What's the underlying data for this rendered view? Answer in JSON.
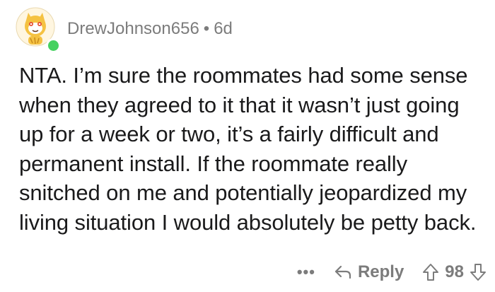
{
  "comment": {
    "username": "DrewJohnson656",
    "separator": "•",
    "age": "6d",
    "body": "NTA. I’m sure the roommates had some sense when they agreed to it that it wasn’t just going up for a week or two, it’s a fairly difficult and permanent install. If the roommate really snitched on me and potentially jeopardized my living situation I would absolutely be petty back."
  },
  "actions": {
    "more_label": "•••",
    "reply_label": "Reply",
    "score": "98"
  },
  "icons": {
    "avatar": "snoo-avatar-icon",
    "reply": "reply-arrow-icon",
    "upvote": "upvote-arrow-icon",
    "downvote": "downvote-arrow-icon"
  },
  "colors": {
    "text": "#1a1a1b",
    "meta": "#7c7c7c",
    "online": "#46d160",
    "avatar_accent": "#f5a623"
  }
}
